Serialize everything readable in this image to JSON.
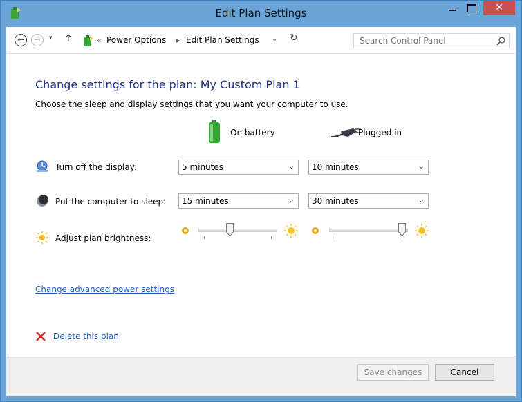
{
  "window": {
    "title": "Edit Plan Settings",
    "close_glyph": "✕"
  },
  "toolbar": {
    "back_glyph": "←",
    "forward_glyph": "→",
    "dropdown_glyph": "▾",
    "up_glyph": "↑",
    "refresh_glyph": "↻"
  },
  "breadcrumb": {
    "overflow": "«",
    "separator": "▸",
    "items": [
      "Power Options",
      "Edit Plan Settings"
    ],
    "dropdown_glyph": "⌄"
  },
  "search": {
    "placeholder": "Search Control Panel"
  },
  "page": {
    "heading": "Change settings for the plan: My Custom Plan 1",
    "subheading": "Choose the sleep and display settings that you want your computer to use."
  },
  "columns": {
    "battery": "On battery",
    "plugged": "Plugged in"
  },
  "settings": {
    "display": {
      "label": "Turn off the display:",
      "battery": "5 minutes",
      "plugged": "10 minutes"
    },
    "sleep": {
      "label": "Put the computer to sleep:",
      "battery": "15 minutes",
      "plugged": "30 minutes"
    },
    "brightness": {
      "label": "Adjust plan brightness:",
      "battery_level": 0.38,
      "plugged_level": 1.0
    }
  },
  "select_arrow": "⌄",
  "links": {
    "advanced": "Change advanced power settings",
    "delete": "Delete this plan"
  },
  "buttons": {
    "save": "Save changes",
    "cancel": "Cancel"
  },
  "colors": {
    "titlebar": "#6ba5d8",
    "heading": "#1e3287",
    "link": "#1e60bd",
    "close": "#c75050"
  },
  "icons": [
    "power-plan-icon",
    "back-icon",
    "forward-icon",
    "up-arrow-icon",
    "refresh-icon",
    "search-icon",
    "battery-icon",
    "plug-icon",
    "display-icon",
    "sleep-icon",
    "brightness-icon",
    "delete-icon"
  ]
}
